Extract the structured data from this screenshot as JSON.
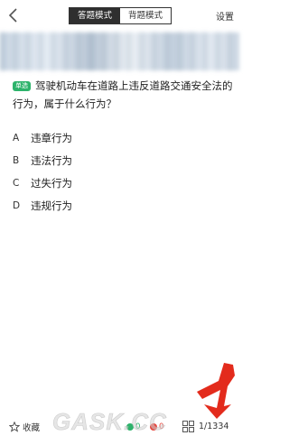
{
  "header": {
    "tabs": [
      {
        "label": "答题模式",
        "active": true
      },
      {
        "label": "背题模式",
        "active": false
      }
    ],
    "settings_label": "设置",
    "back_icon": "chevron-left-icon"
  },
  "question": {
    "type_badge": "单选",
    "text": "驾驶机动车在道路上违反道路交通安全法的行为，属于什么行为？",
    "options": [
      {
        "letter": "A",
        "text": "违章行为"
      },
      {
        "letter": "B",
        "text": "违法行为"
      },
      {
        "letter": "C",
        "text": "过失行为"
      },
      {
        "letter": "D",
        "text": "违规行为"
      }
    ]
  },
  "footer": {
    "favorite_label": "收藏",
    "favorite_icon": "star-icon",
    "correct_count": "0",
    "wrong_count": "0",
    "grid_icon": "grid-icon",
    "progress": "1/1334"
  },
  "overlay": {
    "watermark": "GASK.CC"
  },
  "colors": {
    "badge_green": "#2db36b",
    "active_tab_bg": "#2f2f2f",
    "arrow_red": "#e32b1c",
    "correct_green": "#2db36b",
    "wrong_red": "#e8453c"
  }
}
